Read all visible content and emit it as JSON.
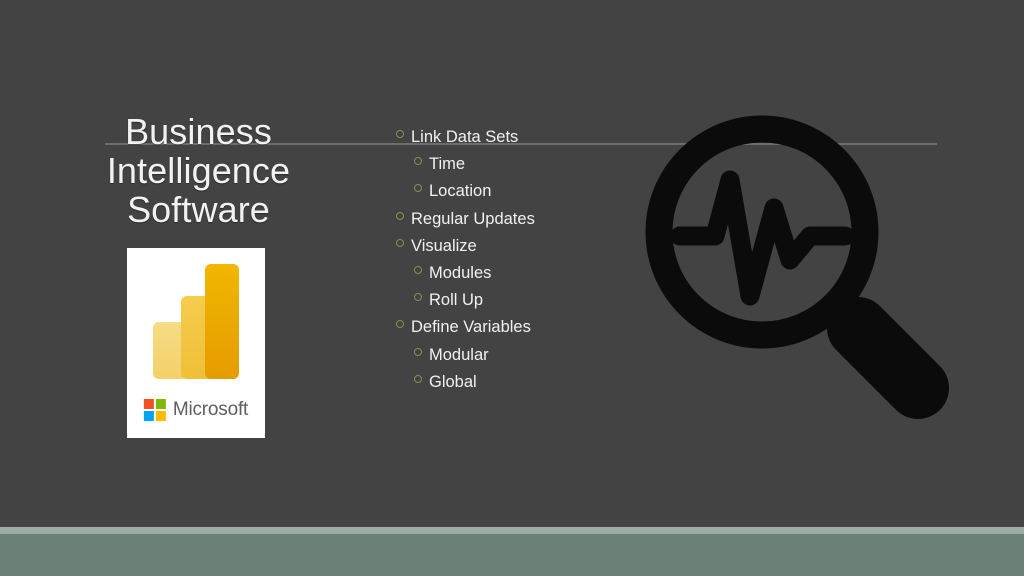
{
  "slide": {
    "background_color": "#434343",
    "title": {
      "lines": [
        "Business",
        "Intelligence",
        "Software"
      ],
      "color": "#f2f2f2"
    },
    "rule": {
      "color": "#6d6d6d"
    },
    "logo_card": {
      "product_name": "Power BI",
      "vendor_wordmark": "Microsoft",
      "card_background": "#ffffff",
      "bar_colors": [
        "#f7dc86",
        "#f5cc4d",
        "#f2b600"
      ],
      "microsoft_square_colors": {
        "red": "#f25022",
        "green": "#7fba00",
        "blue": "#00a4ef",
        "yellow": "#ffb900"
      }
    },
    "bullets": [
      {
        "level": 1,
        "text": "Link Data Sets"
      },
      {
        "level": 2,
        "text": "Time"
      },
      {
        "level": 2,
        "text": "Location"
      },
      {
        "level": 1,
        "text": "Regular Updates"
      },
      {
        "level": 1,
        "text": "Visualize"
      },
      {
        "level": 2,
        "text": "Modules"
      },
      {
        "level": 2,
        "text": "Roll Up"
      },
      {
        "level": 1,
        "text": "Define Variables"
      },
      {
        "level": 2,
        "text": "Modular"
      },
      {
        "level": 2,
        "text": "Global"
      }
    ],
    "bullet_style": {
      "marker": "hollow-circle",
      "marker_color": "#8e8a54",
      "text_color": "#f1f1f1"
    },
    "graphic": {
      "icon_name": "magnifier-pulse-icon",
      "description": "Magnifying glass containing a heartbeat pulse line",
      "color": "#0b0b0b"
    },
    "footer": {
      "accent_strip_color": "#9cada4",
      "band_color": "#6c8175"
    }
  }
}
